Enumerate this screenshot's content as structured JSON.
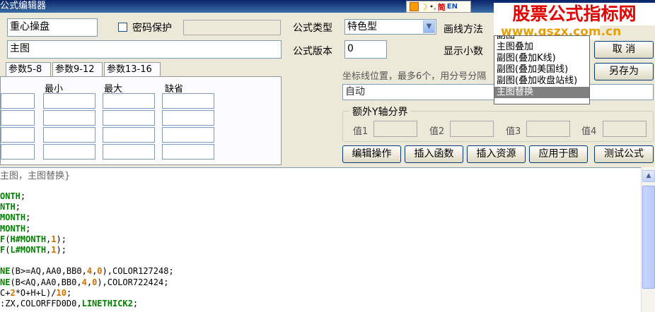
{
  "window": {
    "title": "公式编辑器"
  },
  "ime": {
    "simplified": "简",
    "lang": "EN"
  },
  "formula": {
    "name": "重心操盘",
    "password_label": "密码保护",
    "password_value": "",
    "description": "主图",
    "type_label": "公式类型",
    "type_value": "特色型",
    "version_label": "公式版本",
    "version_value": "0",
    "draw_method_label": "画线方法",
    "decimals_label": "显示小数"
  },
  "buttons": {
    "cancel": "取 消",
    "save_as": "另存为",
    "edit_ops": "编辑操作",
    "insert_func": "插入函数",
    "insert_resource": "插入资源",
    "apply_chart": "应用于图",
    "test_formula": "测试公式"
  },
  "params": {
    "tabs": [
      "参数5-8",
      "参数9-12",
      "参数13-16"
    ],
    "columns": [
      "最小",
      "最大",
      "缺省"
    ]
  },
  "axis": {
    "label": "坐标线位置，最多6个，用分号分隔",
    "value": "自动"
  },
  "extra_y": {
    "title": "额外Y轴分界",
    "labels": [
      "值1",
      "值2",
      "值3",
      "值4"
    ]
  },
  "dropdown": {
    "items": [
      "副图",
      "主图叠加",
      "副图(叠加K线)",
      "副图(叠加美国线)",
      "副图(叠加收盘站线)",
      "主图替换"
    ],
    "selected_index": 5
  },
  "watermark": {
    "title": "股票公式指标网",
    "url": "www.gszx.com.cn"
  },
  "editor": {
    "header": "主图，主图替换}",
    "lines": [
      [
        [
          "k",
          "ONTH"
        ],
        [
          "p",
          ";"
        ]
      ],
      [
        [
          "k",
          "NTH"
        ],
        [
          "p",
          ";"
        ]
      ],
      [
        [
          "k",
          "MONTH"
        ],
        [
          "p",
          ";"
        ]
      ],
      [
        [
          "k",
          "MONTH"
        ],
        [
          "p",
          ";"
        ]
      ],
      [
        [
          "k",
          "F"
        ],
        [
          "p",
          "("
        ],
        [
          "k",
          "H#MONTH"
        ],
        [
          "p",
          ","
        ],
        [
          "n",
          "1"
        ],
        [
          "p",
          ");"
        ]
      ],
      [
        [
          "k",
          "F"
        ],
        [
          "p",
          "("
        ],
        [
          "k",
          "L#MONTH"
        ],
        [
          "p",
          ","
        ],
        [
          "n",
          "1"
        ],
        [
          "p",
          ");"
        ]
      ],
      [],
      [
        [
          "k",
          "NE"
        ],
        [
          "p",
          "(B>=AQ,AA0,BB0,"
        ],
        [
          "n",
          "4"
        ],
        [
          "p",
          ","
        ],
        [
          "n",
          "0"
        ],
        [
          "p",
          "),COLOR127248;"
        ]
      ],
      [
        [
          "k",
          "NE"
        ],
        [
          "p",
          "(B<AQ,AA0,BB0,"
        ],
        [
          "n",
          "4"
        ],
        [
          "p",
          ","
        ],
        [
          "n",
          "0"
        ],
        [
          "p",
          "),COLOR722424;"
        ]
      ],
      [
        [
          "p",
          "C+"
        ],
        [
          "n",
          "2"
        ],
        [
          "p",
          "*O+H+L)/"
        ],
        [
          "n",
          "10"
        ],
        [
          "p",
          ";"
        ]
      ],
      [
        [
          "p",
          ":ZX,COLORFFD0D0,"
        ],
        [
          "k",
          "LINETHICK2"
        ],
        [
          "p",
          ";"
        ]
      ]
    ]
  }
}
